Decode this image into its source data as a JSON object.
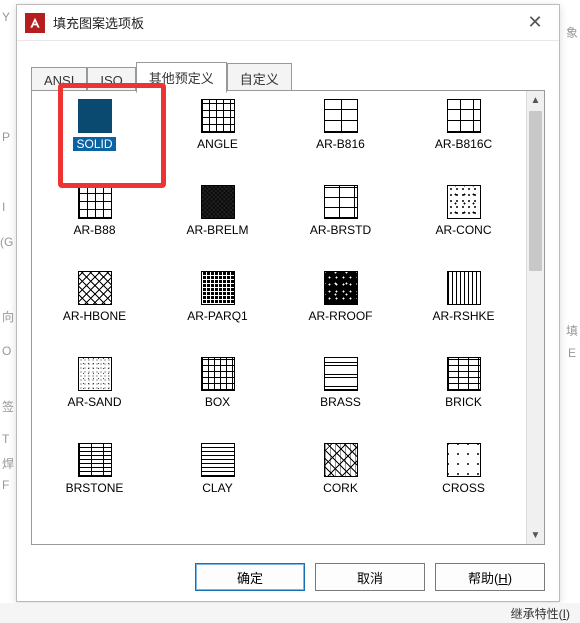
{
  "window": {
    "title": "填充图案选项板"
  },
  "tabs": [
    {
      "label": "ANSI",
      "active": false
    },
    {
      "label": "ISO",
      "active": false
    },
    {
      "label": "其他预定义",
      "active": true
    },
    {
      "label": "自定义",
      "active": false
    }
  ],
  "patterns": [
    {
      "name": "SOLID",
      "swatch": "sw-solid",
      "selected": true
    },
    {
      "name": "ANGLE",
      "swatch": "sw-angle",
      "selected": false
    },
    {
      "name": "AR-B816",
      "swatch": "sw-arb816",
      "selected": false
    },
    {
      "name": "AR-B816C",
      "swatch": "sw-arb816c",
      "selected": false
    },
    {
      "name": "AR-B88",
      "swatch": "sw-arb88",
      "selected": false
    },
    {
      "name": "AR-BRELM",
      "swatch": "sw-arbrelm",
      "selected": false
    },
    {
      "name": "AR-BRSTD",
      "swatch": "sw-arbrstd",
      "selected": false
    },
    {
      "name": "AR-CONC",
      "swatch": "sw-arconc",
      "selected": false
    },
    {
      "name": "AR-HBONE",
      "swatch": "sw-arhbone",
      "selected": false
    },
    {
      "name": "AR-PARQ1",
      "swatch": "sw-arparq1",
      "selected": false
    },
    {
      "name": "AR-RROOF",
      "swatch": "sw-arrroof",
      "selected": false
    },
    {
      "name": "AR-RSHKE",
      "swatch": "sw-arrshke",
      "selected": false
    },
    {
      "name": "AR-SAND",
      "swatch": "sw-arsand",
      "selected": false
    },
    {
      "name": "BOX",
      "swatch": "sw-box",
      "selected": false
    },
    {
      "name": "BRASS",
      "swatch": "sw-brass",
      "selected": false
    },
    {
      "name": "BRICK",
      "swatch": "sw-brick",
      "selected": false
    },
    {
      "name": "BRSTONE",
      "swatch": "sw-brstone",
      "selected": false
    },
    {
      "name": "CLAY",
      "swatch": "sw-clay",
      "selected": false
    },
    {
      "name": "CORK",
      "swatch": "sw-cork",
      "selected": false
    },
    {
      "name": "CROSS",
      "swatch": "sw-cross",
      "selected": false
    }
  ],
  "buttons": {
    "ok": "确定",
    "cancel": "取消",
    "help_prefix": "帮助(",
    "help_key": "H",
    "help_suffix": ")"
  },
  "footer": {
    "inherit_prefix": "继承特性(",
    "inherit_key": "I",
    "inherit_suffix": ")"
  },
  "bg": {
    "l1": "Y",
    "l2": "P",
    "l3": "I",
    "l4": "(G",
    "l5": "向",
    "l6": "O",
    "l7": "签",
    "l8": "T",
    "l9": "焊",
    "l10": "F",
    "r1": "象",
    "r2": "填",
    "r3": "E"
  }
}
